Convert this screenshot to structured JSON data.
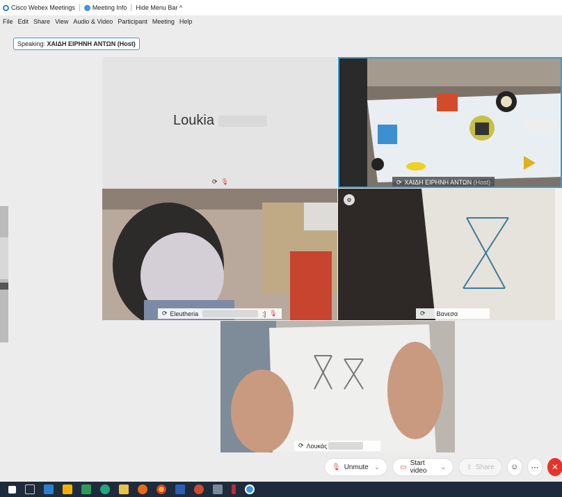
{
  "titlebar": {
    "app_name": "Cisco Webex Meetings",
    "meeting_info": "Meeting Info",
    "hide_menu": "Hide Menu Bar ^"
  },
  "menu": [
    "File",
    "Edit",
    "Share",
    "View",
    "Audio & Video",
    "Participant",
    "Meeting",
    "Help"
  ],
  "speaking": {
    "label": "Speaking:",
    "name": "ΧΑΙΔΗ ΕΙΡΗΝΗ ΑΝΤΩΝ (Host)"
  },
  "tiles": {
    "loukia": {
      "name": "Loukia"
    },
    "host": {
      "name": "ΧΑΙΔΗ ΕΙΡΗΝΗ ΑΝΤΩΝ",
      "role": "(Host)"
    },
    "eleutheria": {
      "name": "Eleutheria",
      "suffix": ":]"
    },
    "vanessa": {
      "name": "Βανεσα"
    },
    "loukas": {
      "name": "Λουκάς"
    }
  },
  "controls": {
    "unmute": "Unmute",
    "start_video": "Start video",
    "share": "Share"
  },
  "colors": {
    "accent": "#3a9bd5",
    "end_red": "#e6332a",
    "mute_red": "#e04040"
  }
}
